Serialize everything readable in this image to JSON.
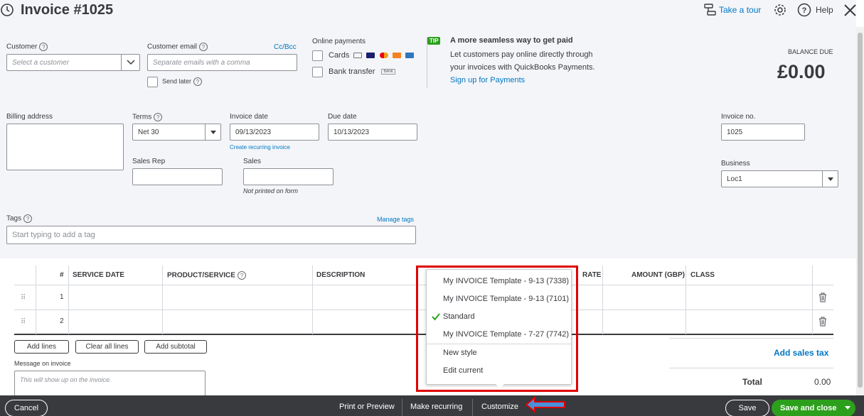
{
  "header": {
    "title": "Invoice #1025",
    "take_tour": "Take a tour",
    "help": "Help"
  },
  "customer": {
    "label": "Customer",
    "placeholder": "Select a customer",
    "email_label": "Customer email",
    "email_placeholder": "Separate emails with a comma",
    "ccbcc": "Cc/Bcc",
    "send_later": "Send later"
  },
  "online_payments": {
    "label": "Online payments",
    "cards": "Cards",
    "bank_transfer": "Bank transfer",
    "bank_logo": "BANK"
  },
  "tip": {
    "badge": "TIP",
    "title": "A more seamless way to get paid",
    "line1": "Let customers pay online directly through",
    "line2": "your invoices with QuickBooks Payments.",
    "link": "Sign up for Payments"
  },
  "balance": {
    "label": "BALANCE DUE",
    "amount": "£0.00"
  },
  "billing": {
    "label": "Billing address"
  },
  "terms": {
    "label": "Terms",
    "value": "Net 30"
  },
  "invoice_date": {
    "label": "Invoice date",
    "value": "09/13/2023",
    "recurring_link": "Create recurring invoice"
  },
  "due_date": {
    "label": "Due date",
    "value": "10/13/2023"
  },
  "invoice_no": {
    "label": "Invoice no.",
    "value": "1025"
  },
  "business": {
    "label": "Business",
    "value": "Loc1"
  },
  "sales_rep": {
    "label": "Sales Rep"
  },
  "sales": {
    "label": "Sales",
    "note": "Not printed on form"
  },
  "tags": {
    "label": "Tags",
    "manage": "Manage tags",
    "placeholder": "Start typing to add a tag"
  },
  "table": {
    "headers": {
      "num": "#",
      "service_date": "SERVICE DATE",
      "product": "PRODUCT/SERVICE",
      "description": "DESCRIPTION",
      "rate": "RATE",
      "amount": "AMOUNT (GBP)",
      "class": "CLASS"
    },
    "rows": [
      {
        "num": "1"
      },
      {
        "num": "2"
      }
    ]
  },
  "actions": {
    "add_lines": "Add lines",
    "clear_lines": "Clear all lines",
    "add_subtotal": "Add subtotal",
    "add_sales_tax": "Add sales tax"
  },
  "message": {
    "label": "Message on invoice",
    "placeholder": "This will show up on the invoice."
  },
  "totals": {
    "label": "Total",
    "value": "0.00"
  },
  "template_menu": {
    "items": [
      "My INVOICE Template - 9-13 (7338)",
      "My INVOICE Template - 9-13 (7101)",
      "Standard",
      "My INVOICE Template - 7-27 (7742)"
    ],
    "checked_index": 2,
    "new_style": "New style",
    "edit_current": "Edit current"
  },
  "footer": {
    "cancel": "Cancel",
    "print_preview": "Print or Preview",
    "make_recurring": "Make recurring",
    "customize": "Customize",
    "save": "Save",
    "save_close": "Save and close"
  },
  "colors": {
    "brand_green": "#2ca01c",
    "link_blue": "#0077c5",
    "footer_bg": "#393a3d",
    "highlight_red": "#e00000",
    "arrow_blue": "#4a90d9"
  }
}
